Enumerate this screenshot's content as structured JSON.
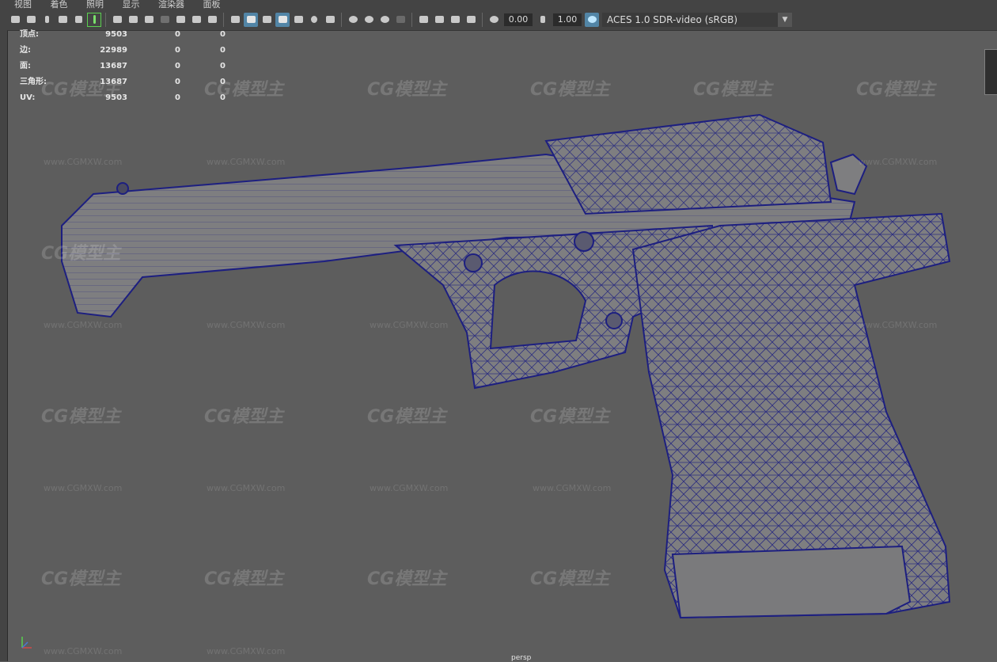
{
  "menu": [
    "视图",
    "着色",
    "照明",
    "显示",
    "渲染器",
    "面板"
  ],
  "toolbar": {
    "exposure_value": "0.00",
    "gamma_value": "1.00",
    "color_space": "ACES 1.0 SDR-video (sRGB)"
  },
  "hud": [
    {
      "label": "顶点:",
      "v1": "9503",
      "v2": "0",
      "v3": "0"
    },
    {
      "label": "边:",
      "v1": "22989",
      "v2": "0",
      "v3": "0"
    },
    {
      "label": "面:",
      "v1": "13687",
      "v2": "0",
      "v3": "0"
    },
    {
      "label": "三角形:",
      "v1": "13687",
      "v2": "0",
      "v3": "0"
    },
    {
      "label": "UV:",
      "v1": "9503",
      "v2": "0",
      "v3": "0"
    }
  ],
  "camera_label": "persp",
  "watermark_text": "CG模型主",
  "watermark_url": "www.CGMXW.com",
  "colors": {
    "viewport": "#5d5d5d",
    "wireframe": "#1d1f80",
    "mesh": "#7e7e80",
    "accent": "#5285a6"
  }
}
